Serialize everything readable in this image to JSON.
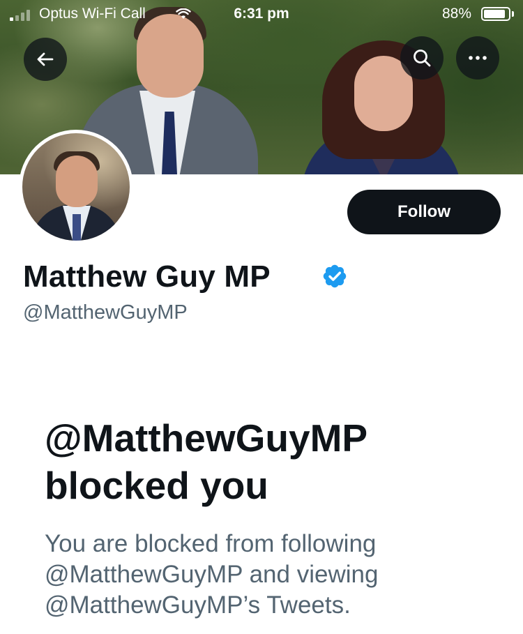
{
  "status_bar": {
    "carrier": "Optus Wi-Fi Call",
    "time": "6:31 pm",
    "battery_percent": "88%",
    "battery_level": 0.88,
    "signal_bars_filled": 1,
    "signal_bars_total": 4
  },
  "header": {
    "back_icon": "arrow-left-icon",
    "search_icon": "search-icon",
    "more_icon": "ellipsis-icon"
  },
  "profile": {
    "display_name": "Matthew Guy MP",
    "handle": "@MatthewGuyMP",
    "verified": true,
    "follow_label": "Follow"
  },
  "blocked": {
    "title": "@MatthewGuyMP blocked you",
    "description": "You are blocked from following @MatthewGuyMP and viewing @MatthewGuyMP’s Tweets."
  },
  "colors": {
    "text_primary": "#0f1419",
    "text_secondary": "#536471",
    "verified_blue": "#1d9bf0",
    "button_dark": "#0f1419"
  }
}
